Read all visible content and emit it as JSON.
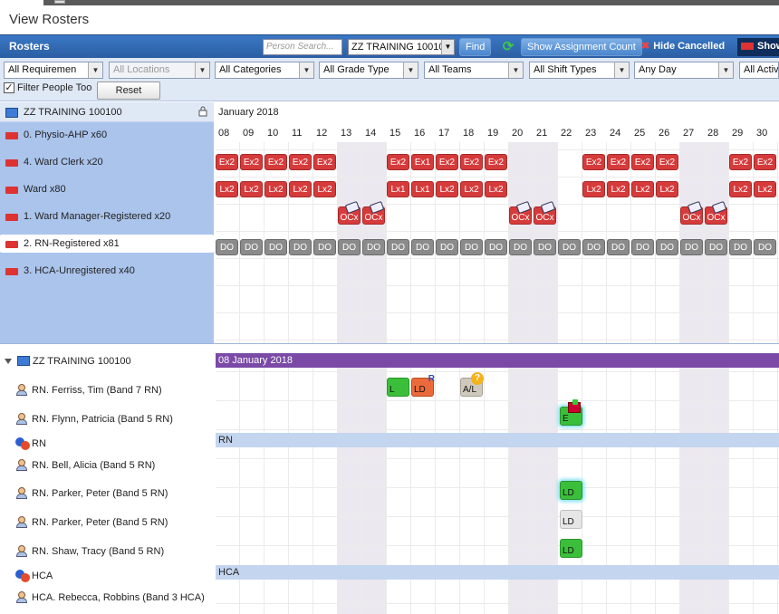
{
  "page_title": "View Rosters",
  "header": {
    "title": "Rosters",
    "search_placeholder": "Person Search...",
    "unit_select": "ZZ TRAINING 10010",
    "find_label": "Find",
    "show_assign_label": "Show Assignment Count",
    "hide_cancelled_label": "Hide Cancelled",
    "show_label": "Show"
  },
  "filters": {
    "requirements": "All Requiremen",
    "locations": "All Locations",
    "categories": "All Categories",
    "grade_type": "All Grade Type",
    "teams": "All Teams",
    "shift_types": "All Shift Types",
    "day": "Any Day",
    "active": "All Activ",
    "filter_people_label": "Filter People Too",
    "reset_label": "Reset"
  },
  "top_unit": "ZZ TRAINING 100100",
  "month_label": "January 2018",
  "days": [
    "08",
    "09",
    "10",
    "11",
    "12",
    "13",
    "14",
    "15",
    "16",
    "17",
    "18",
    "19",
    "20",
    "21",
    "22",
    "23",
    "24",
    "25",
    "26",
    "27",
    "28",
    "29",
    "30"
  ],
  "groups": [
    "0. Physio-AHP x60",
    "4. Ward Clerk x20",
    "Ward  x80",
    "1. Ward Manager-Registered x20",
    "2. RN-Registered x81",
    "3. HCA-Unregistered x40"
  ],
  "shift_rows": {
    "ward_clerk": [
      "Ex2",
      "Ex2",
      "Ex2",
      "Ex2",
      "Ex2",
      "",
      "",
      "Ex2",
      "Ex1",
      "Ex2",
      "Ex2",
      "Ex2",
      "",
      "",
      "",
      "Ex2",
      "Ex2",
      "Ex2",
      "Ex2",
      "",
      "",
      "Ex2",
      "Ex2"
    ],
    "ward": [
      "Lx2",
      "Lx2",
      "Lx2",
      "Lx2",
      "Lx2",
      "",
      "",
      "Lx1",
      "Lx1",
      "Lx2",
      "Lx2",
      "Lx2",
      "",
      "",
      "",
      "Lx2",
      "Lx2",
      "Lx2",
      "Lx2",
      "",
      "",
      "Lx2",
      "Lx2"
    ],
    "manager": [
      "",
      "",
      "",
      "",
      "",
      "OCx",
      "OCx",
      "",
      "",
      "",
      "",
      "",
      "OCx",
      "OCx",
      "",
      "",
      "",
      "",
      "",
      "OCx",
      "OCx",
      "",
      ""
    ],
    "rn": [
      "DO",
      "DO",
      "DO",
      "DO",
      "DO",
      "DO",
      "DO",
      "DO",
      "DO",
      "DO",
      "DO",
      "DO",
      "DO",
      "DO",
      "DO",
      "DO",
      "DO",
      "DO",
      "DO",
      "DO",
      "DO",
      "DO",
      "DO"
    ]
  },
  "detail_unit": "ZZ TRAINING 100100",
  "detail_date": "08 January 2018",
  "people": {
    "ferriss": "RN. Ferriss, Tim (Band 7 RN)",
    "flynn": "RN. Flynn, Patricia (Band 5 RN)",
    "rn_role": "RN",
    "bell": "RN. Bell, Alicia (Band 5 RN)",
    "parker1": "RN. Parker, Peter (Band 5 RN)",
    "parker2": "RN. Parker, Peter (Band 5 RN)",
    "shaw": "RN. Shaw, Tracy (Band 5 RN)",
    "hca_role": "HCA",
    "rebecca": "HCA. Rebecca, Robbins (Band 3 HCA)"
  },
  "person_shifts": {
    "ferriss_l": "L",
    "ferriss_ld": "LD",
    "ferriss_ld_badge": "R",
    "ferriss_al": "A/L",
    "ferriss_al_badge": "?",
    "flynn_e": "E",
    "parker1_ld": "LD",
    "parker2_ld": "LD",
    "shaw_ld": "LD"
  },
  "colors": {
    "header_blue": "#2b5fa3",
    "group_panel": "#aac4ec",
    "shift_red": "#d63b3b",
    "day_off_grey": "#8b8b8b",
    "date_bar_purple": "#7a4aa6",
    "shift_green": "#3bbf3b"
  }
}
